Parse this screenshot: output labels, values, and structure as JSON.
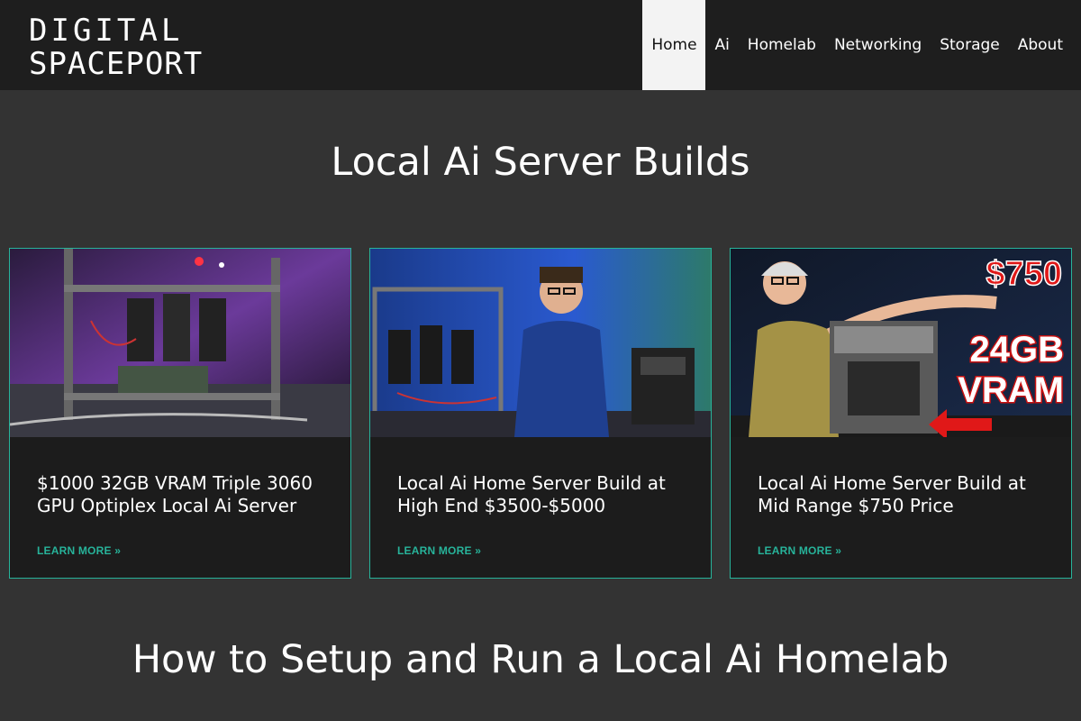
{
  "header": {
    "logo_line1": "DIGITAL",
    "logo_line2": "SPACEPORT",
    "nav": [
      {
        "label": "Home",
        "active": true
      },
      {
        "label": "Ai"
      },
      {
        "label": "Homelab"
      },
      {
        "label": "Networking"
      },
      {
        "label": "Storage"
      },
      {
        "label": "About"
      }
    ]
  },
  "sections": {
    "builds_title": "Local Ai Server Builds",
    "setup_title": "How to Setup and Run a Local Ai Homelab"
  },
  "cards": [
    {
      "title": "$1000 32GB VRAM Triple 3060 GPU Optiplex Local Ai Server",
      "link": "LEARN MORE »"
    },
    {
      "title": "Local Ai Home Server Build at High End $3500-$5000",
      "link": "LEARN MORE »"
    },
    {
      "title": "Local Ai Home Server Build at Mid Range $750 Price",
      "link": "LEARN MORE »",
      "overlay_price": "$750",
      "overlay_vram1": "24GB",
      "overlay_vram2": "VRAM"
    }
  ],
  "colors": {
    "accent": "#27b39a",
    "header_bg": "#1e1e1e",
    "page_bg": "#333333",
    "card_bg": "#1c1c1c"
  }
}
